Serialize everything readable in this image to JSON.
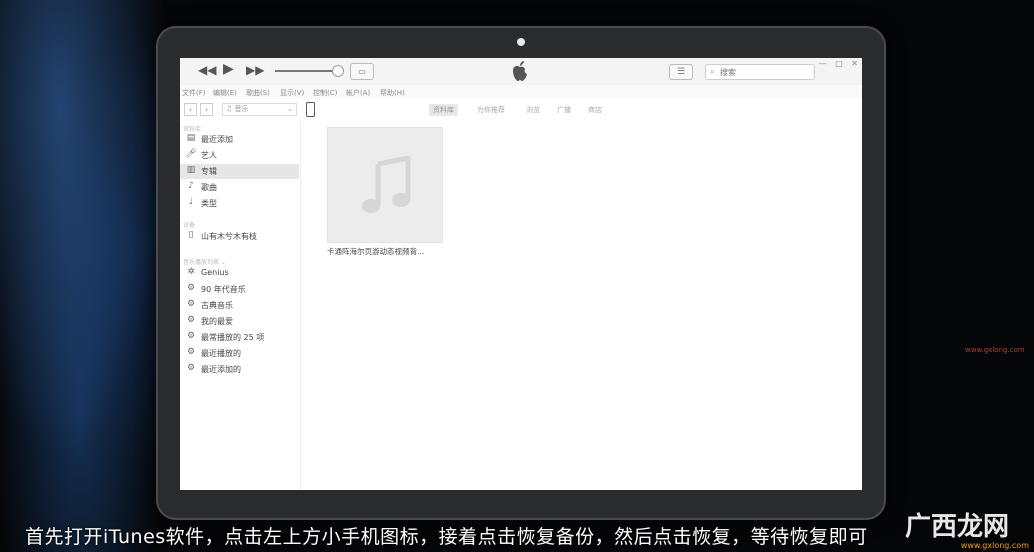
{
  "toolbar": {
    "prev_icon": "rewind-icon",
    "play_icon": "play-icon",
    "next_icon": "fast-forward-icon",
    "search_placeholder": "搜索",
    "window_controls": [
      "—",
      "□",
      "✕"
    ]
  },
  "menubar": [
    "文件(F)",
    "编辑(E)",
    "歌曲(S)",
    "显示(V)",
    "控制(C)",
    "帐户(A)",
    "帮助(H)"
  ],
  "navbar": {
    "library_select": "音乐",
    "tabs": [
      {
        "label": "资料库",
        "active": true
      },
      {
        "label": "为你推荐",
        "active": false
      },
      {
        "label": "浏览",
        "active": false
      },
      {
        "label": "广播",
        "active": false
      },
      {
        "label": "商店",
        "active": false
      }
    ]
  },
  "sidebar": {
    "library_header": "资料库",
    "library_items": [
      {
        "label": "最近添加",
        "icon": "recently-added-icon"
      },
      {
        "label": "艺人",
        "icon": "artist-icon"
      },
      {
        "label": "专辑",
        "icon": "album-icon",
        "selected": true
      },
      {
        "label": "歌曲",
        "icon": "music-note-icon"
      },
      {
        "label": "类型",
        "icon": "genre-icon"
      }
    ],
    "devices_header": "设备",
    "device_item": {
      "label": "山有木兮木有枝",
      "icon": "iphone-icon"
    },
    "playlists_header": "音乐播放列表 ⌄",
    "playlist_items": [
      {
        "label": "Genius",
        "icon": "genius-icon"
      },
      {
        "label": "90 年代音乐",
        "icon": "gear-icon"
      },
      {
        "label": "古典音乐",
        "icon": "gear-icon"
      },
      {
        "label": "我的最爱",
        "icon": "gear-icon"
      },
      {
        "label": "最常播放的 25 项",
        "icon": "gear-icon"
      },
      {
        "label": "最近播放的",
        "icon": "gear-icon"
      },
      {
        "label": "最近添加的",
        "icon": "gear-icon"
      }
    ]
  },
  "content": {
    "album_title": "卡通阵海尔页游动态视频背..."
  },
  "subtitle": "首先打开iTunes软件，点击左上方小手机图标，接着点击恢复备份，然后点击恢复，等待恢复即可",
  "watermark": {
    "cn": "广西龙网",
    "url": "www.gxlong.com"
  },
  "side_url": "www.gxlong.com"
}
